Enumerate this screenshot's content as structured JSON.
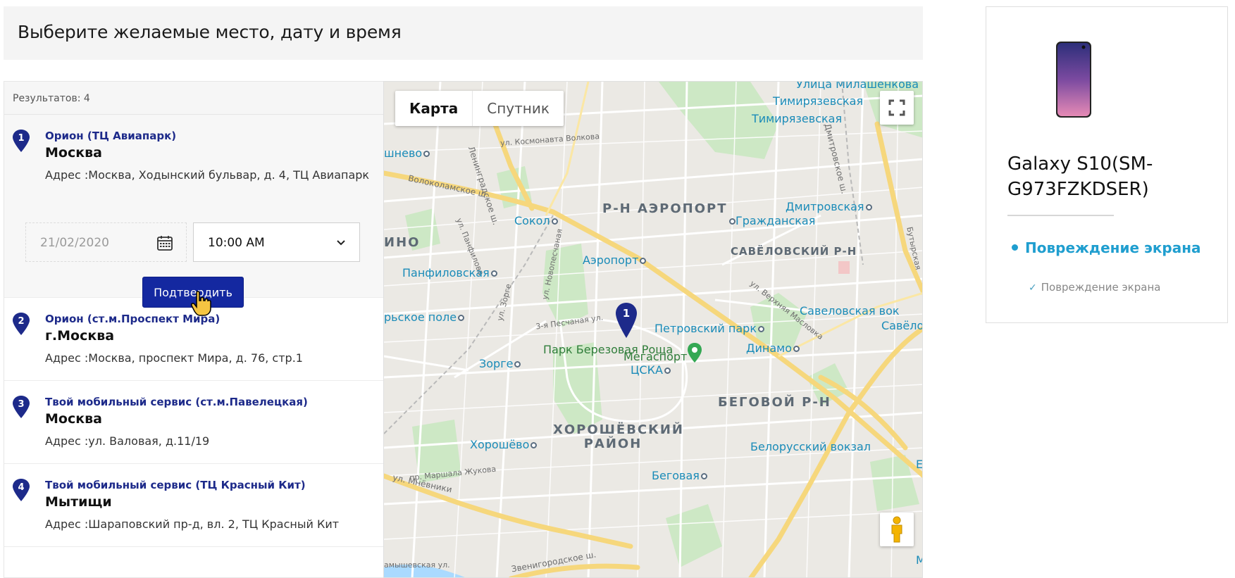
{
  "header": {
    "title": "Выберите желаемые место, дату и время"
  },
  "results": {
    "label": "Результатов: 4"
  },
  "stores": [
    {
      "num": "1",
      "name": "Орион (ТЦ Авиапарк)",
      "city": "Москва",
      "address": "Адрес :Москва, Ходынский бульвар, д. 4, ТЦ Авиапарк"
    },
    {
      "num": "2",
      "name": "Орион (ст.м.Проспект Мира)",
      "city": "г.Москва",
      "address": "Адрес :Москва, проспект Мира, д. 76, стр.1"
    },
    {
      "num": "3",
      "name": "Твой мобильный сервис (ст.м.Павелецкая)",
      "city": "Москва",
      "address": "Адрес :ул. Валовая, д.11/19"
    },
    {
      "num": "4",
      "name": "Твой мобильный сервис (ТЦ Красный Кит)",
      "city": "Мытищи",
      "address": "Адрес :Шараповский пр-д, вл. 2, ТЦ Красный Кит"
    }
  ],
  "booking": {
    "date_placeholder": "21/02/2020",
    "time_value": "10:00 AM",
    "confirm_label": "Подтвердить"
  },
  "map": {
    "type_map": "Карта",
    "type_satellite": "Спутник",
    "marker_num": "1",
    "labels": {
      "ulitsa_milashenkova": "Улица Милашенкова",
      "timiryazevskaya1": "Тимирязевская",
      "timiryazevskaya2": "Тимирязевская",
      "leningradskoe": "Ленинградское ш.",
      "kosmonavta": "ул. Космонавта Волкова",
      "dmitrovskoe": "Дмитровское ш.",
      "shnevo": "шнево",
      "volokolamskoe": "Волоколамское ш.",
      "aeroport_district": "Р-Н АЭРОПОРТ",
      "sokol": "Сокол",
      "grazhdanskaya": "Гражданская",
      "dmitrovskaya": "Дмитровская",
      "pankratova": "ул. Панфилова",
      "ino": "ИНО",
      "aeroport_metro": "Аэропорт",
      "savelovsky": "САВЁЛОВСКИЙ Р-Н",
      "panfilovskaya": "Панфиловская",
      "novopeschanaya": "ул. Новопесчаная",
      "zorge_street": "ул. Зорге",
      "peschanaya": "3-я Песчаная ул.",
      "savelovskaya_vok": "Савеловская вок",
      "savelov": "Савёлов",
      "strelnoe_pole": "рьское поле",
      "petrovsky_park": "Петровский парк",
      "dinamo": "Динамо",
      "park_berezovaya": "Парк Березовая Роща",
      "zorge_metro": "Зорге",
      "megasport": "Мегаспорт",
      "cska": "ЦСКА",
      "begovoy": "БЕГОВОЙ Р-Н",
      "khoroshevsky": "ХОРОШЁВСКИЙ РАЙОН",
      "khoroshevo": "Хорошёво",
      "belorussky": "Белорусский вокзал",
      "marshala": "пр. Маршала Жукова",
      "mnevniki": "ул. Мнёвники",
      "begovaya": "Беговая",
      "zvenigorodskoe": "Звенигородское ш.",
      "amyshevskaya": "амышевская ул.",
      "butyrskaya": "Бутырская",
      "ul_verkhnyaya": "ул. Верхняя Масловка",
      "right_edge_e": "Е",
      "right_edge_m": "М"
    }
  },
  "product": {
    "title": "Galaxy S10(SM-G973FZKDSER)",
    "issue_main": "Повреждение экрана",
    "issue_sub": "Повреждение экрана"
  },
  "colors": {
    "primary": "#1428a0",
    "accent": "#1f9ecf",
    "pin": "#1d2a8a"
  }
}
